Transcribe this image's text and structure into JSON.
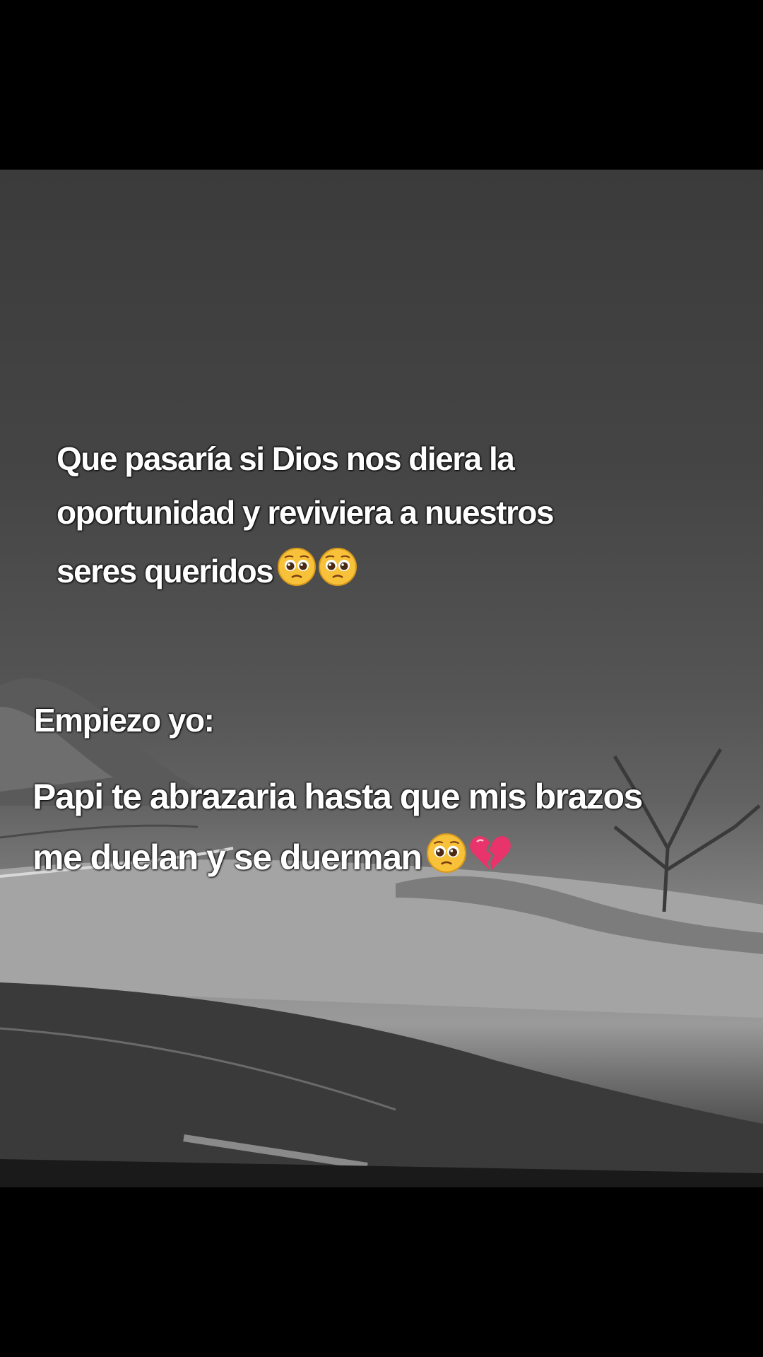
{
  "question": {
    "line1": "Que pasaría si Dios nos diera la",
    "line2": "oportunidad y reviviera a nuestros",
    "line3": "seres queridos",
    "line3_emojis": [
      "pleading-face-emoji",
      "pleading-face-emoji"
    ]
  },
  "prompt": {
    "text": "Empiezo yo:"
  },
  "answer": {
    "line1": "Papi te abrazaria hasta que mis brazos",
    "line2": "me duelan y se duerman",
    "line2_emojis": [
      "pleading-face-emoji",
      "broken-heart-emoji"
    ]
  },
  "colors": {
    "letterbox": "#000000",
    "text": "#ffffff",
    "emoji_face": "#f7c23a",
    "broken_heart": "#e8336b"
  }
}
